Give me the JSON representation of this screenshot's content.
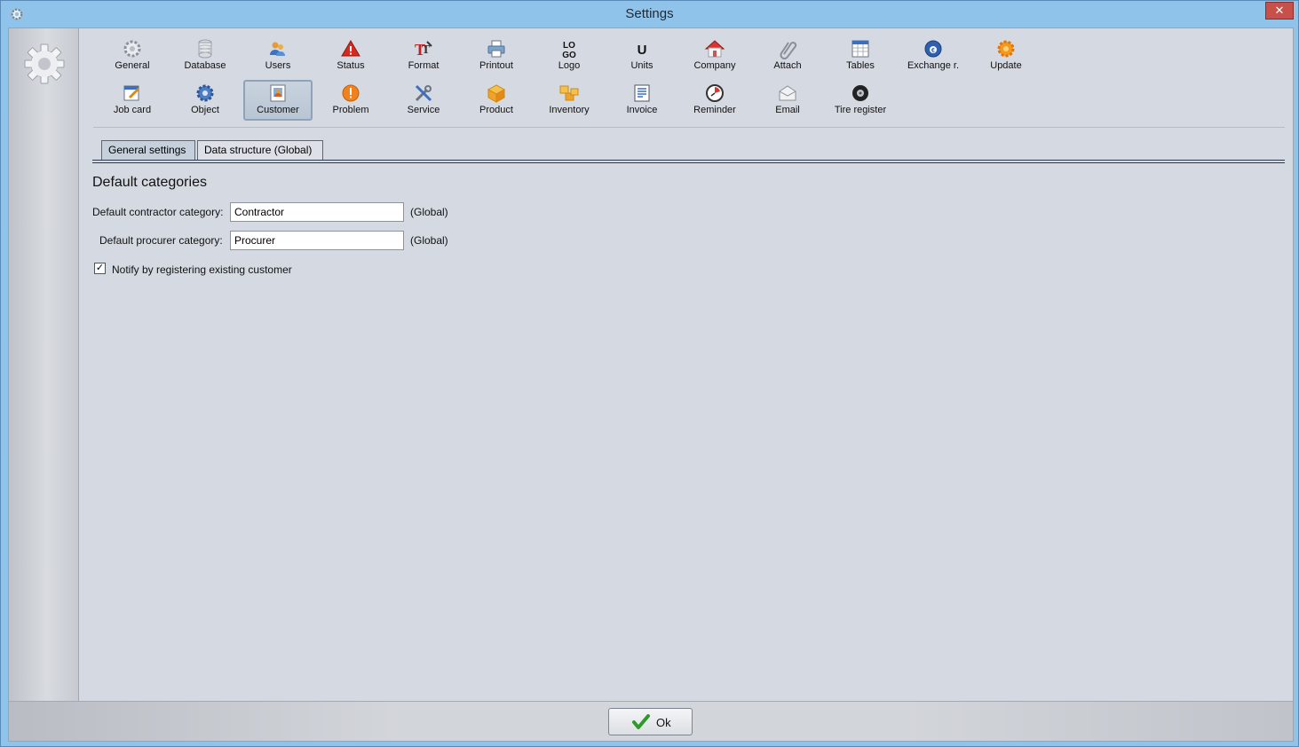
{
  "window": {
    "title": "Settings",
    "close_glyph": "✕"
  },
  "toolbar": {
    "items": [
      {
        "label": "General",
        "icon": "gear-icon"
      },
      {
        "label": "Database",
        "icon": "database-icon"
      },
      {
        "label": "Users",
        "icon": "users-icon"
      },
      {
        "label": "Status",
        "icon": "warning-icon"
      },
      {
        "label": "Format",
        "icon": "format-icon"
      },
      {
        "label": "Printout",
        "icon": "printer-icon"
      },
      {
        "label": "Logo",
        "icon": "logo-icon",
        "glyph": "LO\nGO"
      },
      {
        "label": "Units",
        "icon": "units-icon",
        "glyph": "U"
      },
      {
        "label": "Company",
        "icon": "house-icon"
      },
      {
        "label": "Attach",
        "icon": "paperclip-icon"
      },
      {
        "label": "Tables",
        "icon": "table-icon"
      },
      {
        "label": "Exchange r.",
        "icon": "exchange-icon"
      },
      {
        "label": "Update",
        "icon": "update-icon"
      },
      {
        "label": "Job card",
        "icon": "job-card-icon"
      },
      {
        "label": "Object",
        "icon": "object-gear-icon"
      },
      {
        "label": "Customer",
        "icon": "customer-icon"
      },
      {
        "label": "Problem",
        "icon": "problem-icon"
      },
      {
        "label": "Service",
        "icon": "tools-icon"
      },
      {
        "label": "Product",
        "icon": "box-icon"
      },
      {
        "label": "Inventory",
        "icon": "boxes-icon"
      },
      {
        "label": "Invoice",
        "icon": "invoice-icon"
      },
      {
        "label": "Reminder",
        "icon": "reminder-icon"
      },
      {
        "label": "Email",
        "icon": "email-icon"
      },
      {
        "label": "Tire register",
        "icon": "tire-icon"
      }
    ],
    "active": "Customer"
  },
  "tabs": [
    {
      "label": "General settings",
      "active": true
    },
    {
      "label": "Data structure (Global)",
      "active": false
    }
  ],
  "section": {
    "title": "Default categories",
    "contractor": {
      "label": "Default contractor category:",
      "value": "Contractor",
      "note": "(Global)"
    },
    "procurer": {
      "label": "Default procurer category:",
      "value": "Procurer",
      "note": "(Global)"
    },
    "notify": {
      "label": "Notify by registering existing customer",
      "checked": true,
      "check_glyph": "✓"
    }
  },
  "footer": {
    "ok_label": "Ok"
  },
  "colors": {
    "accent": "#8fc3ea",
    "close": "#c7504a",
    "panel": "#d5d9e1"
  }
}
